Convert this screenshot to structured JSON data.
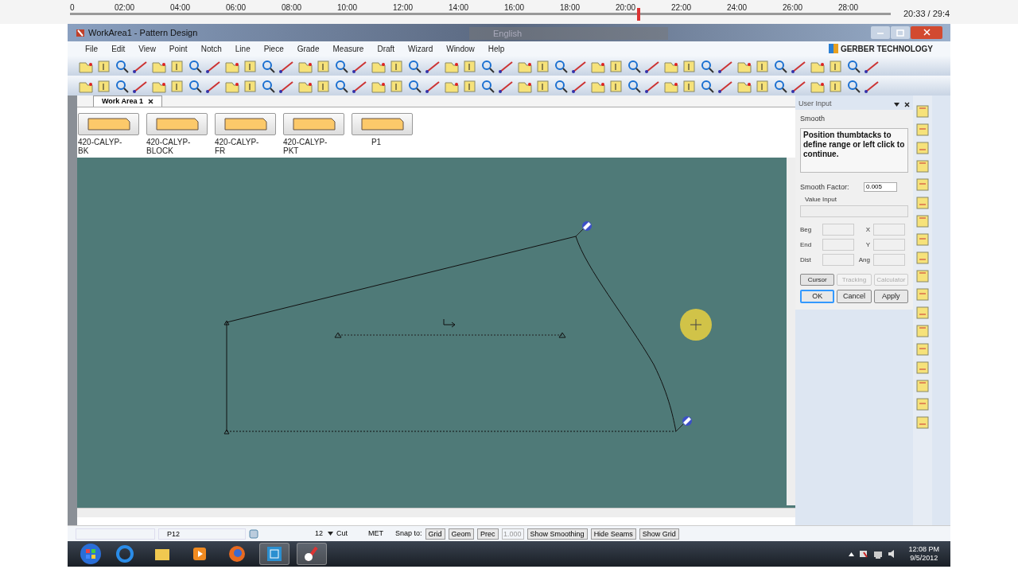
{
  "player": {
    "ticks": [
      "0",
      "02:00",
      "04:00",
      "06:00",
      "08:00",
      "10:00",
      "12:00",
      "14:00",
      "16:00",
      "18:00",
      "20:00",
      "22:00",
      "24:00",
      "26:00",
      "28:00"
    ],
    "level": 0.693,
    "time": "20:33 / 29:4"
  },
  "window": {
    "title": "WorkArea1 - Pattern Design",
    "language_bar": "English",
    "brand": "GERBER TECHNOLOGY"
  },
  "menu": [
    "File",
    "Edit",
    "View",
    "Point",
    "Notch",
    "Line",
    "Piece",
    "Grade",
    "Measure",
    "Draft",
    "Wizard",
    "Window",
    "Help"
  ],
  "tabs": [
    {
      "label": "Work Area 1",
      "selected": true
    }
  ],
  "pieces": [
    {
      "label": "420-CALYP-BK"
    },
    {
      "label": "420-CALYP-BLOCK"
    },
    {
      "label": "420-CALYP-FR"
    },
    {
      "label": "420-CALYP-PKT"
    },
    {
      "label": "P1"
    }
  ],
  "user_input": {
    "title": "User Input",
    "mode": "Smooth",
    "prompt": "Position thumbtacks to define range or left click to continue.",
    "smooth_factor": {
      "label": "Smooth Factor:",
      "value": "0.005"
    },
    "value_input": "Value Input",
    "fields": [
      "Beg",
      "End",
      "Dist"
    ],
    "fields_2": [
      "X",
      "Y",
      "Ang"
    ],
    "tool_buttons": [
      {
        "label": "Cursor",
        "disabled": false
      },
      {
        "label": "Tracking",
        "disabled": true
      },
      {
        "label": "Calculator",
        "disabled": true
      }
    ],
    "buttons": [
      {
        "label": "OK",
        "selected": true
      },
      {
        "label": "Cancel",
        "selected": false
      },
      {
        "label": "Apply",
        "selected": false
      }
    ]
  },
  "status_bar": {
    "piece": "P12",
    "size": "12",
    "mode": "Cut",
    "units": "MET",
    "snap_label": "Snap to:",
    "snap": [
      {
        "label": "Grid"
      },
      {
        "label": "Geom"
      },
      {
        "label": "Prec"
      }
    ],
    "precision": "1.000",
    "buttons": [
      "Show Smoothing",
      "Hide Seams",
      "Show Grid"
    ]
  },
  "taskbar": {
    "time": "12:08 PM",
    "date": "9/5/2012"
  }
}
